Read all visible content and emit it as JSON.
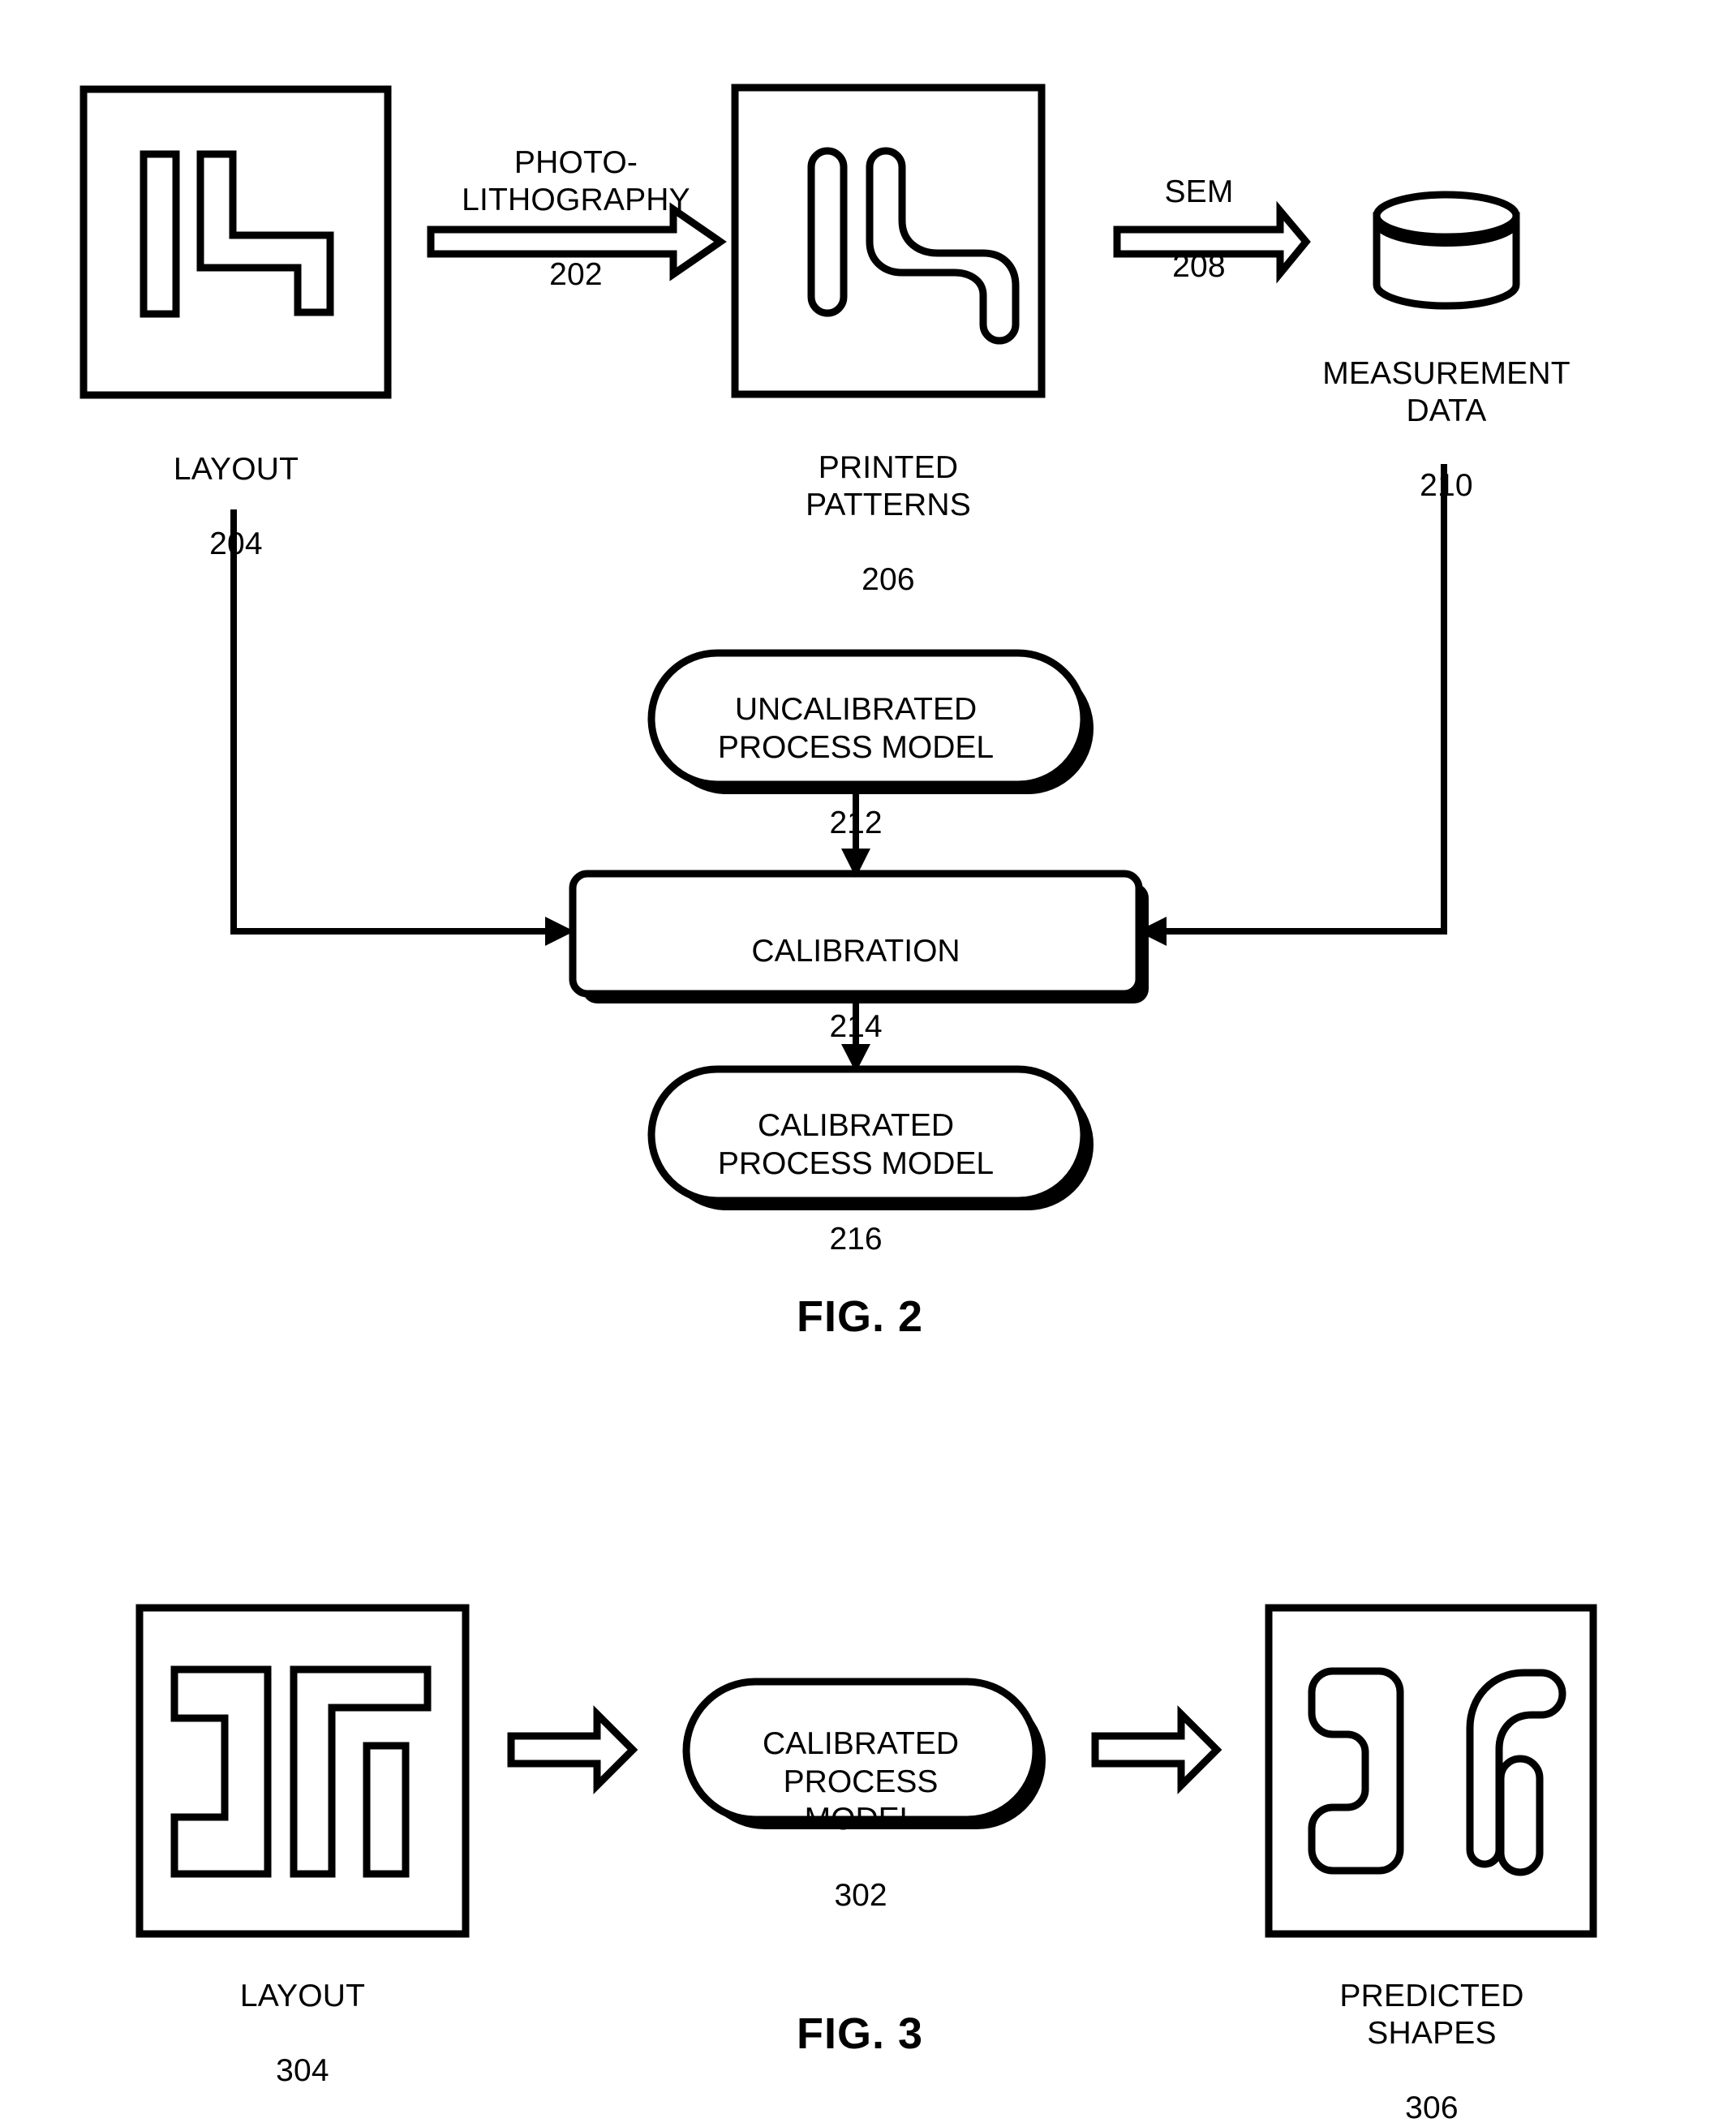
{
  "figures": [
    {
      "id": "fig2",
      "caption": "FIG. 2",
      "nodes": {
        "layout_box": {
          "label": "LAYOUT",
          "ref": "204"
        },
        "photolithography_arrow": {
          "label": "PHOTO-\nLITHOGRAPHY",
          "ref": "202"
        },
        "printed_patterns_box": {
          "label": "PRINTED\nPATTERNS",
          "ref": "206"
        },
        "sem_arrow": {
          "label": "SEM",
          "ref": "208"
        },
        "measurement_data_db": {
          "label": "MEASUREMENT\nDATA",
          "ref": "210"
        },
        "uncalibrated_model": {
          "label": "UNCALIBRATED\nPROCESS MODEL",
          "ref": "212"
        },
        "calibration": {
          "label": "CALIBRATION",
          "ref": "214"
        },
        "calibrated_model": {
          "label": "CALIBRATED\nPROCESS MODEL",
          "ref": "216"
        }
      }
    },
    {
      "id": "fig3",
      "caption": "FIG. 3",
      "nodes": {
        "layout_box": {
          "label": "LAYOUT",
          "ref": "304"
        },
        "calibrated_model": {
          "label": "CALIBRATED\nPROCESS MODEL",
          "ref": "302"
        },
        "predicted_shapes_box": {
          "label": "PREDICTED\nSHAPES",
          "ref": "306"
        }
      }
    }
  ],
  "style": {
    "stroke": "#000000",
    "fill": "#ffffff",
    "background": "#ffffff"
  }
}
